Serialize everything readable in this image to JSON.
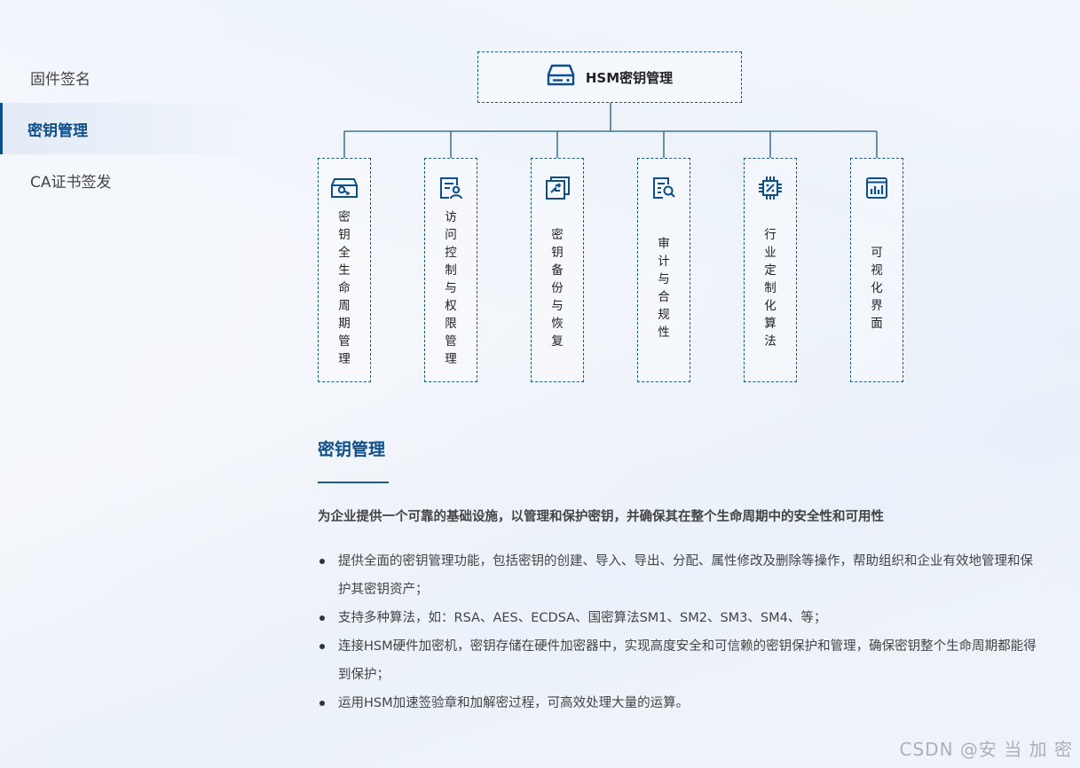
{
  "sidebar": {
    "items": [
      {
        "label": "固件签名",
        "active": false
      },
      {
        "label": "密钥管理",
        "active": true
      },
      {
        "label": "CA证书签发",
        "active": false
      }
    ]
  },
  "diagram": {
    "root": {
      "label": "HSM密钥管理",
      "icon": "server-icon"
    },
    "children": [
      {
        "label": "密钥全生命周期管理",
        "icon": "key-icon"
      },
      {
        "label": "访问控制与权限管理",
        "icon": "user-document-icon"
      },
      {
        "label": "密钥备份与恢复",
        "icon": "backup-restore-icon"
      },
      {
        "label": "审计与合规性",
        "icon": "document-search-icon"
      },
      {
        "label": "行业定制化算法",
        "icon": "chip-icon"
      },
      {
        "label": "可视化界面",
        "icon": "bar-chart-icon"
      }
    ]
  },
  "content": {
    "title": "密钥管理",
    "subtitle": "为企业提供一个可靠的基础设施，以管理和保护密钥，并确保其在整个生命周期中的安全性和可用性",
    "bullets": [
      "提供全面的密钥管理功能，包括密钥的创建、导入、导出、分配、属性修改及删除等操作，帮助组织和企业有效地管理和保护其密钥资产；",
      "支持多种算法，如：RSA、AES、ECDSA、国密算法SM1、SM2、SM3、SM4、等；",
      "连接HSM硬件加密机，密钥存储在硬件加密器中，实现高度安全和可信赖的密钥保护和管理，确保密钥整个生命周期都能得到保护；",
      "运用HSM加速签验章和加解密过程，可高效处理大量的运算。"
    ]
  },
  "watermark": "CSDN @安 当 加 密",
  "colors": {
    "accent": "#0d4f8c",
    "line": "#1f5a84"
  }
}
